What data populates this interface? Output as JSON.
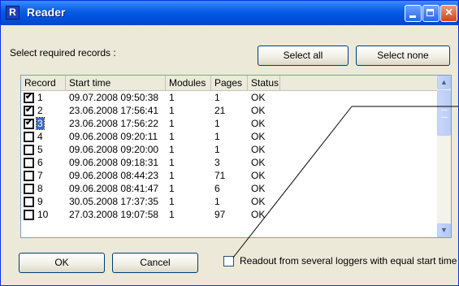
{
  "window": {
    "title": "Reader",
    "app_icon_letter": "R"
  },
  "prompt": "Select required records :",
  "buttons": {
    "select_all": "Select all",
    "select_none": "Select none",
    "ok": "OK",
    "cancel": "Cancel"
  },
  "table": {
    "columns": [
      "Record",
      "Start time",
      "Modules",
      "Pages",
      "Status"
    ],
    "rows": [
      {
        "record": "1",
        "start": "09.07.2008 09:50:38",
        "modules": "1",
        "pages": "1",
        "status": "OK",
        "checked": true,
        "selected": false
      },
      {
        "record": "2",
        "start": "23.06.2008 17:56:41",
        "modules": "1",
        "pages": "21",
        "status": "OK",
        "checked": true,
        "selected": false
      },
      {
        "record": "3",
        "start": "23.06.2008 17:56:22",
        "modules": "1",
        "pages": "1",
        "status": "OK",
        "checked": true,
        "selected": true
      },
      {
        "record": "4",
        "start": "09.06.2008 09:20:11",
        "modules": "1",
        "pages": "1",
        "status": "OK",
        "checked": false,
        "selected": false
      },
      {
        "record": "5",
        "start": "09.06.2008 09:20:00",
        "modules": "1",
        "pages": "1",
        "status": "OK",
        "checked": false,
        "selected": false
      },
      {
        "record": "6",
        "start": "09.06.2008 09:18:31",
        "modules": "1",
        "pages": "3",
        "status": "OK",
        "checked": false,
        "selected": false
      },
      {
        "record": "7",
        "start": "09.06.2008 08:44:23",
        "modules": "1",
        "pages": "71",
        "status": "OK",
        "checked": false,
        "selected": false
      },
      {
        "record": "8",
        "start": "09.06.2008 08:41:47",
        "modules": "1",
        "pages": "6",
        "status": "OK",
        "checked": false,
        "selected": false
      },
      {
        "record": "9",
        "start": "30.05.2008 17:37:35",
        "modules": "1",
        "pages": "1",
        "status": "OK",
        "checked": false,
        "selected": false
      },
      {
        "record": "10",
        "start": "27.03.2008 19:07:58",
        "modules": "1",
        "pages": "97",
        "status": "OK",
        "checked": false,
        "selected": false
      }
    ]
  },
  "option": {
    "label": "Readout from several loggers with equal start time",
    "checked": false
  },
  "icons": {
    "minimize": "minimize-icon",
    "maximize": "maximize-icon",
    "close": "close-icon",
    "scroll_up": "arrow-up-icon",
    "scroll_down": "arrow-down-icon"
  },
  "colors": {
    "titlebar": "#0054e3",
    "selection": "#316ac5",
    "dialog_bg": "#ece9d8"
  }
}
